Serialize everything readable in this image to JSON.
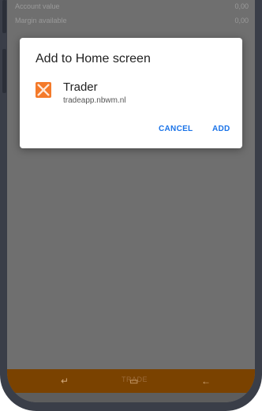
{
  "background_rows": [
    {
      "label": "Account value",
      "value": "0,00"
    },
    {
      "label": "Margin available",
      "value": "0,00"
    },
    {
      "label": "",
      "value": ""
    }
  ],
  "dialog": {
    "title": "Add to Home screen",
    "app_name": "Trader",
    "app_url": "tradeapp.nbwm.nl",
    "cancel_label": "CANCEL",
    "add_label": "ADD"
  },
  "bottom_bar": {
    "tab_label": "TRADE"
  },
  "colors": {
    "accent": "#1a73e8",
    "bottom_bar": "#7a4200",
    "icon_orange": "#f47a2a"
  }
}
